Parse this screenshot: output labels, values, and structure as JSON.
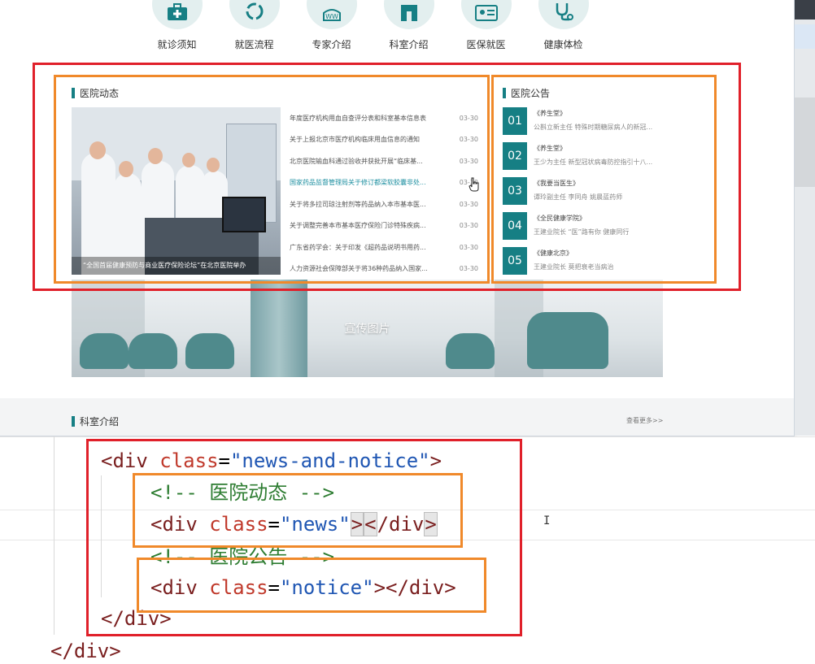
{
  "quick_nav": [
    {
      "label": "就诊须知",
      "icon": "medical-kit-icon"
    },
    {
      "label": "就医流程",
      "icon": "cycle-icon"
    },
    {
      "label": "专家介绍",
      "icon": "doctor-icon"
    },
    {
      "label": "科室介绍",
      "icon": "building-icon"
    },
    {
      "label": "医保就医",
      "icon": "id-card-icon"
    },
    {
      "label": "健康体检",
      "icon": "stethoscope-icon"
    }
  ],
  "news": {
    "title": "医院动态",
    "photo_caption": "“全国首届健康预防与商业医疗保险论坛”在北京医院举办",
    "items": [
      {
        "title": "年度医疗机构用血自查评分表和科室基本信息表",
        "date": "03-30"
      },
      {
        "title": "关于上报北京市医疗机构临床用血信息的通知",
        "date": "03-30"
      },
      {
        "title": "北京医院输血科通过验收并获批开展“临床基...",
        "date": "03-30"
      },
      {
        "title": "国家药品监督管理局关于修订都梁软胶囊非处...",
        "date": "03-30"
      },
      {
        "title": "关于将多拉司琼注射剂等药品纳入本市基本医...",
        "date": "03-30"
      },
      {
        "title": "关于调整完善本市基本医疗保险门诊特殊疾病...",
        "date": "03-30"
      },
      {
        "title": "广东省药学会：关于印发《超药品说明书用药...",
        "date": "03-30"
      },
      {
        "title": "人力资源社会保障部关于将36种药品纳入国家...",
        "date": "03-30"
      }
    ]
  },
  "notice": {
    "title": "医院公告",
    "items": [
      {
        "num": "01",
        "title": "《养生堂》",
        "sub": "公斟立新主任 特殊时期糖尿病人的新冠..."
      },
      {
        "num": "02",
        "title": "《养生堂》",
        "sub": "王少为主任 新型冠状病毒防控指引十八..."
      },
      {
        "num": "03",
        "title": "《我要当医生》",
        "sub": "谭玲副主任 李同舟 姚晨蓝药师"
      },
      {
        "num": "04",
        "title": "《全民健康学院》",
        "sub": "王建业院长 “医”路有你 健康同行"
      },
      {
        "num": "05",
        "title": "《健康北京》",
        "sub": "王建业院长 莫把衰老当病治"
      }
    ]
  },
  "promo": {
    "label": "宣传图片"
  },
  "dept": {
    "title": "科室介绍",
    "more": "查看更多>>"
  },
  "code": {
    "line1_open": "<",
    "line1_tag": "div",
    "line1_attr": "class",
    "line1_eq": "=",
    "line1_val": "\"news-and-notice\"",
    "line1_close": ">",
    "comment1": "<!-- 医院动态 -->",
    "line3_open": "<",
    "line3_tag": "div",
    "line3_attr": "class",
    "line3_eq": "=",
    "line3_val": "\"news\"",
    "line3_close": ">",
    "line3_end_open": "<",
    "line3_end_tag": "/div",
    "line3_end_close": ">",
    "comment2": "<!-- 医院公告 -->",
    "line5_open": "<",
    "line5_tag": "div",
    "line5_attr": "class",
    "line5_eq": "=",
    "line5_val": "\"notice\"",
    "line5_close": "></div>",
    "line6": "</div>",
    "line7": "</div>"
  },
  "colors": {
    "accent": "#167f84",
    "annotation_red": "#e0202a",
    "annotation_orange": "#f0892a"
  }
}
